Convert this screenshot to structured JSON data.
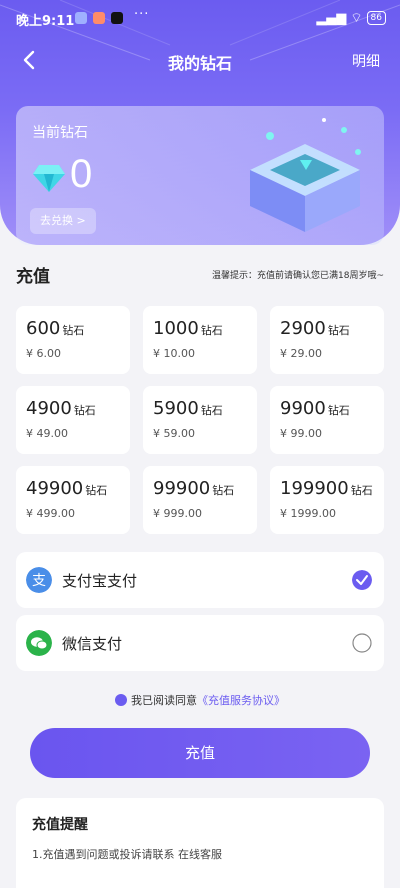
{
  "status_bar": {
    "time": "晚上9:11",
    "dots": "···",
    "battery": "86"
  },
  "header": {
    "title": "我的钻石",
    "detail_label": "明细"
  },
  "balance_card": {
    "label": "当前钻石",
    "amount": "0",
    "exchange_label": "去兑换 >"
  },
  "recharge": {
    "heading": "充值",
    "tip": "温馨提示：充值前请确认您已满18周岁哦~",
    "unit": "钻石",
    "packages": [
      {
        "amount": "600",
        "price": "¥ 6.00"
      },
      {
        "amount": "1000",
        "price": "¥ 10.00"
      },
      {
        "amount": "2900",
        "price": "¥ 29.00"
      },
      {
        "amount": "4900",
        "price": "¥ 49.00"
      },
      {
        "amount": "5900",
        "price": "¥ 59.00"
      },
      {
        "amount": "9900",
        "price": "¥ 99.00"
      },
      {
        "amount": "49900",
        "price": "¥ 499.00"
      },
      {
        "amount": "99900",
        "price": "¥ 999.00"
      },
      {
        "amount": "199900",
        "price": "¥ 1999.00"
      }
    ]
  },
  "payment": {
    "alipay_label": "支付宝支付",
    "wechat_label": "微信支付",
    "selected": "alipay"
  },
  "agreement": {
    "text": "我已阅读同意",
    "link": "《充值服务协议》"
  },
  "submit_label": "充值",
  "notes": {
    "title": "充值提醒",
    "line1": "1.充值遇到问题或投诉请联系 在线客服"
  },
  "colors": {
    "accent": "#6b5cf0",
    "alipay": "#4a8ee8",
    "wechat": "#2bb34a"
  }
}
